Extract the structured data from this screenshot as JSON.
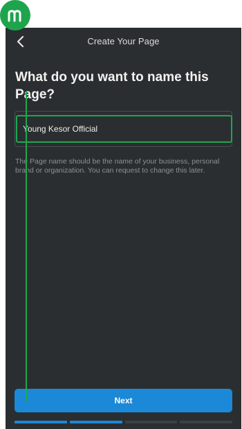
{
  "header": {
    "title": "Create Your Page",
    "back_icon": "chevron-left-icon"
  },
  "logo": {
    "icon": "m-logo-icon",
    "color": "#1fa44e"
  },
  "form": {
    "heading": "What do you want to name this Page?",
    "name_value": "Young Kesor Official",
    "helper": "The Page name should be the name of your business, personal brand or organization. You can request to change this later."
  },
  "footer": {
    "next_label": "Next",
    "progress": {
      "current_step": 2,
      "total_steps": 4
    }
  },
  "colors": {
    "background": "#2b2e30",
    "accent_blue": "#1c88d8",
    "highlight_green": "#1ea84f"
  }
}
